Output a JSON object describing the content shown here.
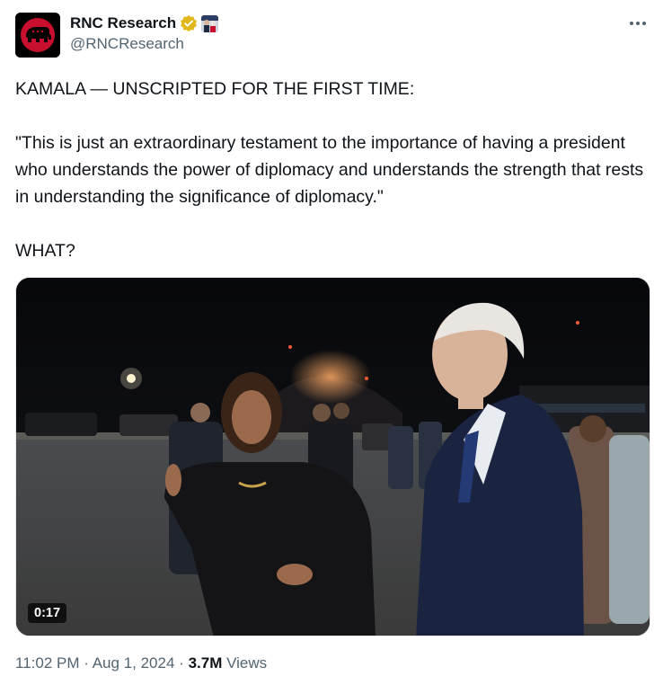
{
  "author": {
    "display_name": "RNC Research",
    "handle": "@RNCResearch",
    "avatar_icon": "republican-elephant-logo",
    "verified_color": "#e2b719"
  },
  "tweet": {
    "line1": "KAMALA — UNSCRIPTED FOR THE FIRST TIME:",
    "quote": "\"This is just an extraordinary testament to the importance of having a president who understands the power of diplomacy and understands the strength that rests in understanding the significance of diplomacy.\"",
    "line3": "WHAT?"
  },
  "video": {
    "duration": "0:17"
  },
  "meta": {
    "time": "11:02 PM",
    "date": "Aug 1, 2024",
    "views_count": "3.7M",
    "views_label": "Views",
    "separator": "·"
  },
  "colors": {
    "text_primary": "#0f1419",
    "text_secondary": "#536471",
    "brand_red": "#c8102e"
  }
}
